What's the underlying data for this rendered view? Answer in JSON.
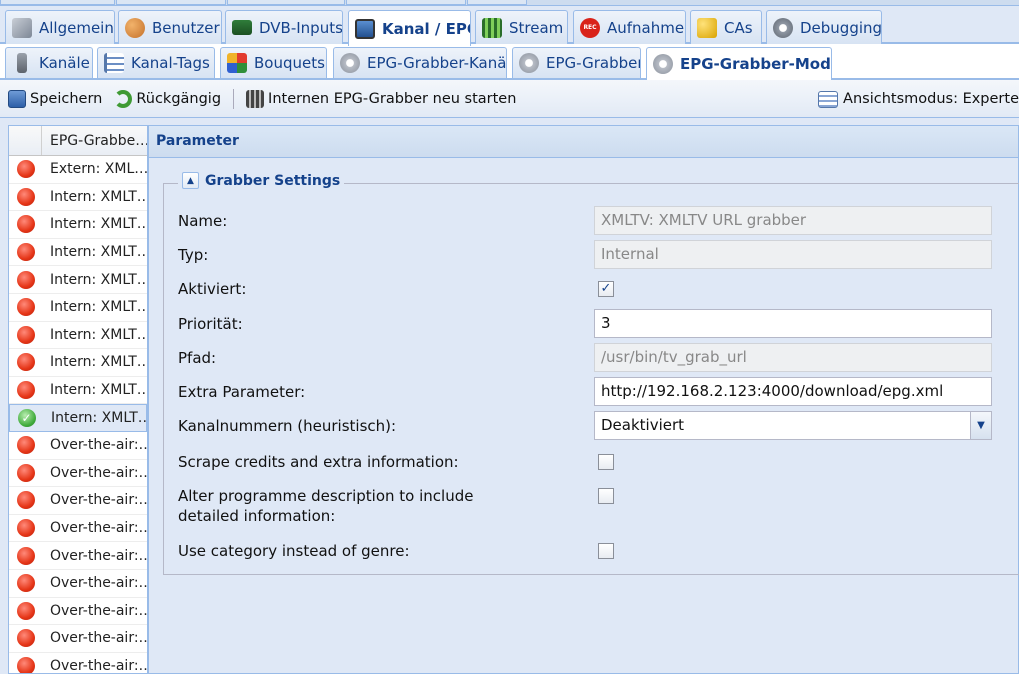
{
  "main_tabs": [
    {
      "label": "Allgemein",
      "icon": "wrench-icon"
    },
    {
      "label": "Benutzer",
      "icon": "users-icon"
    },
    {
      "label": "DVB-Inputs",
      "icon": "card-icon"
    },
    {
      "label": "Kanal / EPG",
      "icon": "tv-icon",
      "active": true
    },
    {
      "label": "Stream",
      "icon": "film-icon"
    },
    {
      "label": "Aufnahme",
      "icon": "rec-icon"
    },
    {
      "label": "CAs",
      "icon": "key-icon"
    },
    {
      "label": "Debugging",
      "icon": "gears-icon"
    }
  ],
  "sub_tabs": [
    {
      "label": "Kanäle",
      "icon": "remote-icon"
    },
    {
      "label": "Kanal-Tags",
      "icon": "tree-icon"
    },
    {
      "label": "Bouquets",
      "icon": "grid-icon"
    },
    {
      "label": "EPG-Grabber-Kanäle",
      "icon": "gear-icon"
    },
    {
      "label": "EPG-Grabber",
      "icon": "gear-icon"
    },
    {
      "label": "EPG-Grabber-Module",
      "icon": "gear-icon",
      "active": true
    }
  ],
  "toolbar": {
    "save": "Speichern",
    "undo": "Rückgängig",
    "restart": "Internen EPG-Grabber neu starten",
    "view_mode": "Ansichtsmodus: Experte"
  },
  "grid": {
    "header": "EPG-Grabbe…",
    "rows": [
      {
        "name": "Extern: XML…",
        "status": "inactive"
      },
      {
        "name": "Intern: XMLT…",
        "status": "inactive"
      },
      {
        "name": "Intern: XMLT…",
        "status": "inactive"
      },
      {
        "name": "Intern: XMLT…",
        "status": "inactive"
      },
      {
        "name": "Intern: XMLT…",
        "status": "inactive"
      },
      {
        "name": "Intern: XMLT…",
        "status": "inactive"
      },
      {
        "name": "Intern: XMLT…",
        "status": "inactive"
      },
      {
        "name": "Intern: XMLT…",
        "status": "inactive"
      },
      {
        "name": "Intern: XMLT…",
        "status": "inactive"
      },
      {
        "name": "Intern: XMLT…",
        "status": "active",
        "selected": true
      },
      {
        "name": "Over-the-air:…",
        "status": "inactive"
      },
      {
        "name": "Over-the-air:…",
        "status": "inactive"
      },
      {
        "name": "Over-the-air:…",
        "status": "inactive"
      },
      {
        "name": "Over-the-air:…",
        "status": "inactive"
      },
      {
        "name": "Over-the-air:…",
        "status": "inactive"
      },
      {
        "name": "Over-the-air:…",
        "status": "inactive"
      },
      {
        "name": "Over-the-air:…",
        "status": "inactive"
      },
      {
        "name": "Over-the-air:…",
        "status": "inactive"
      },
      {
        "name": "Over-the-air:…",
        "status": "inactive"
      }
    ]
  },
  "panel": {
    "title": "Parameter",
    "fieldset_title": "Grabber Settings",
    "fields": {
      "name_label": "Name:",
      "name_value": "XMLTV: XMLTV URL grabber",
      "type_label": "Typ:",
      "type_value": "Internal",
      "enabled_label": "Aktiviert:",
      "enabled_checked": true,
      "priority_label": "Priorität:",
      "priority_value": "3",
      "path_label": "Pfad:",
      "path_value": "/usr/bin/tv_grab_url",
      "extra_label": "Extra Parameter:",
      "extra_value": "http://192.168.2.123:4000/download/epg.xml",
      "channum_label": "Kanalnummern (heuristisch):",
      "channum_value": "Deaktiviert",
      "scrape_label": "Scrape credits and extra information:",
      "scrape_checked": false,
      "alter_label": "Alter programme description to include detailed information:",
      "alter_checked": false,
      "category_label": "Use category instead of genre:",
      "category_checked": false
    }
  },
  "colors": {
    "accent": "#15428b",
    "border": "#99bbe8",
    "inactive_status": "#e53517",
    "active_status": "#3faa3a"
  }
}
